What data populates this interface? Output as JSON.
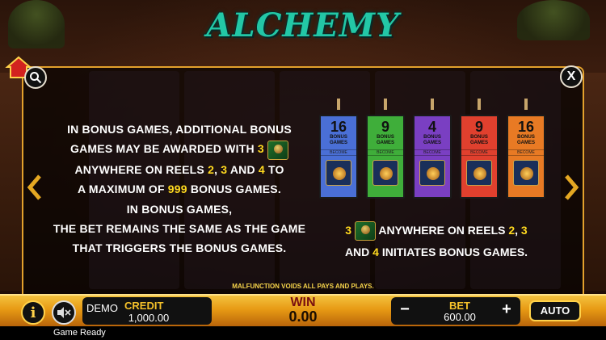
{
  "game": {
    "title": "ALCHEMY"
  },
  "help": {
    "paragraph1": {
      "l1": "IN BONUS GAMES, ADDITIONAL BONUS",
      "l2a": "GAMES MAY BE AWARDED WITH",
      "l2b": "3",
      "l3a": "ANYWHERE ON REELS",
      "l3b": "2",
      "l3c": ",",
      "l3d": "3",
      "l3e": "AND",
      "l3f": "4",
      "l3g": "TO",
      "l4a": "A MAXIMUM OF",
      "l4b": "999",
      "l4c": "BONUS GAMES.",
      "l5": "IN BONUS GAMES,",
      "l6": "THE BET REMAINS THE SAME AS THE GAME",
      "l7": "THAT TRIGGERS THE BONUS GAMES."
    },
    "paragraph2": {
      "l1a": "3",
      "l1b": "ANYWHERE ON REELS",
      "l1c": "2",
      "l1d": ",",
      "l1e": "3",
      "l2a": "AND",
      "l2b": "4",
      "l2c": "INITIATES BONUS GAMES."
    },
    "cards": [
      {
        "number": "16",
        "label": "BONUS GAMES",
        "become": "BECOME",
        "color": "#4a6fd6"
      },
      {
        "number": "9",
        "label": "BONUS GAMES",
        "become": "BECOME",
        "color": "#3fae3a"
      },
      {
        "number": "4",
        "label": "BONUS GAMES",
        "become": "BECOME",
        "color": "#7a3fc2"
      },
      {
        "number": "9",
        "label": "BONUS GAMES",
        "become": "BECOME",
        "color": "#e0402e"
      },
      {
        "number": "16",
        "label": "BONUS GAMES",
        "become": "BECOME",
        "color": "#e87a24"
      }
    ],
    "malfunction": "MALFUNCTION VOIDS ALL PAYS AND PLAYS."
  },
  "controls": {
    "close_icon": "X",
    "info_icon": "i",
    "sound_icon": "mute-icon",
    "demo": "DEMO",
    "credit_label": "CREDIT",
    "credit_value": "1,000.00",
    "win_label": "WIN",
    "win_value": "0.00",
    "bet_label": "BET",
    "bet_value": "600.00",
    "minus": "−",
    "plus": "+",
    "auto": "AUTO",
    "status": "Game Ready"
  }
}
